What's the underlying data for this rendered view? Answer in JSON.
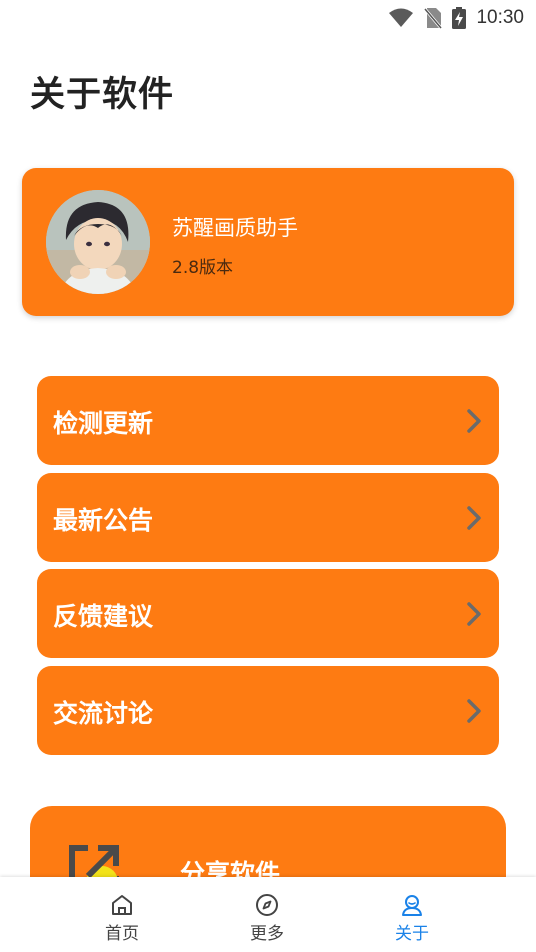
{
  "status_bar": {
    "time": "10:30",
    "icons": [
      "wifi-icon",
      "no-sim-icon",
      "battery-charging-icon"
    ]
  },
  "page": {
    "title": "关于软件"
  },
  "app_card": {
    "name": "苏醒画质助手",
    "version": "2.8版本",
    "accent_color": "#fe7b12"
  },
  "menu": {
    "items": [
      {
        "label": "检测更新",
        "icon": "chevron-right-icon"
      },
      {
        "label": "最新公告",
        "icon": "chevron-right-icon"
      },
      {
        "label": "反馈建议",
        "icon": "chevron-right-icon"
      },
      {
        "label": "交流讨论",
        "icon": "chevron-right-icon"
      }
    ]
  },
  "share": {
    "label": "分享软件",
    "icon": "share-icon"
  },
  "bottom_nav": {
    "items": [
      {
        "label": "首页",
        "icon": "home-icon",
        "active": false
      },
      {
        "label": "更多",
        "icon": "compass-icon",
        "active": false
      },
      {
        "label": "关于",
        "icon": "user-icon",
        "active": true
      }
    ],
    "active_color": "#1a82e8"
  }
}
